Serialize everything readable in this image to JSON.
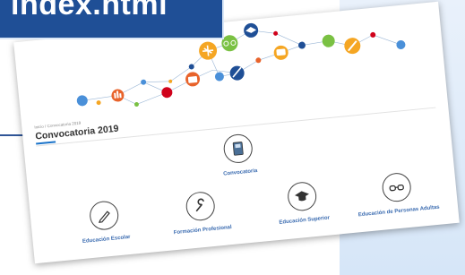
{
  "banner": {
    "title": "index.html"
  },
  "page": {
    "breadcrumb": "Inicio / Convocatoria 2019",
    "title": "Convocatoria 2019"
  },
  "items": [
    {
      "label": "Convocatoria",
      "icon": "book-icon"
    },
    {
      "label": "Educación Escolar",
      "icon": "pencil-icon"
    },
    {
      "label": "Formación Profesional",
      "icon": "wrench-icon"
    },
    {
      "label": "Educación Superior",
      "icon": "graduation-cap-icon"
    },
    {
      "label": "Educación de Personas Adultas",
      "icon": "glasses-icon"
    }
  ],
  "colors": {
    "banner": "#1f4f96",
    "label": "#3a6bb0",
    "title_accent": "#1a73c9"
  }
}
